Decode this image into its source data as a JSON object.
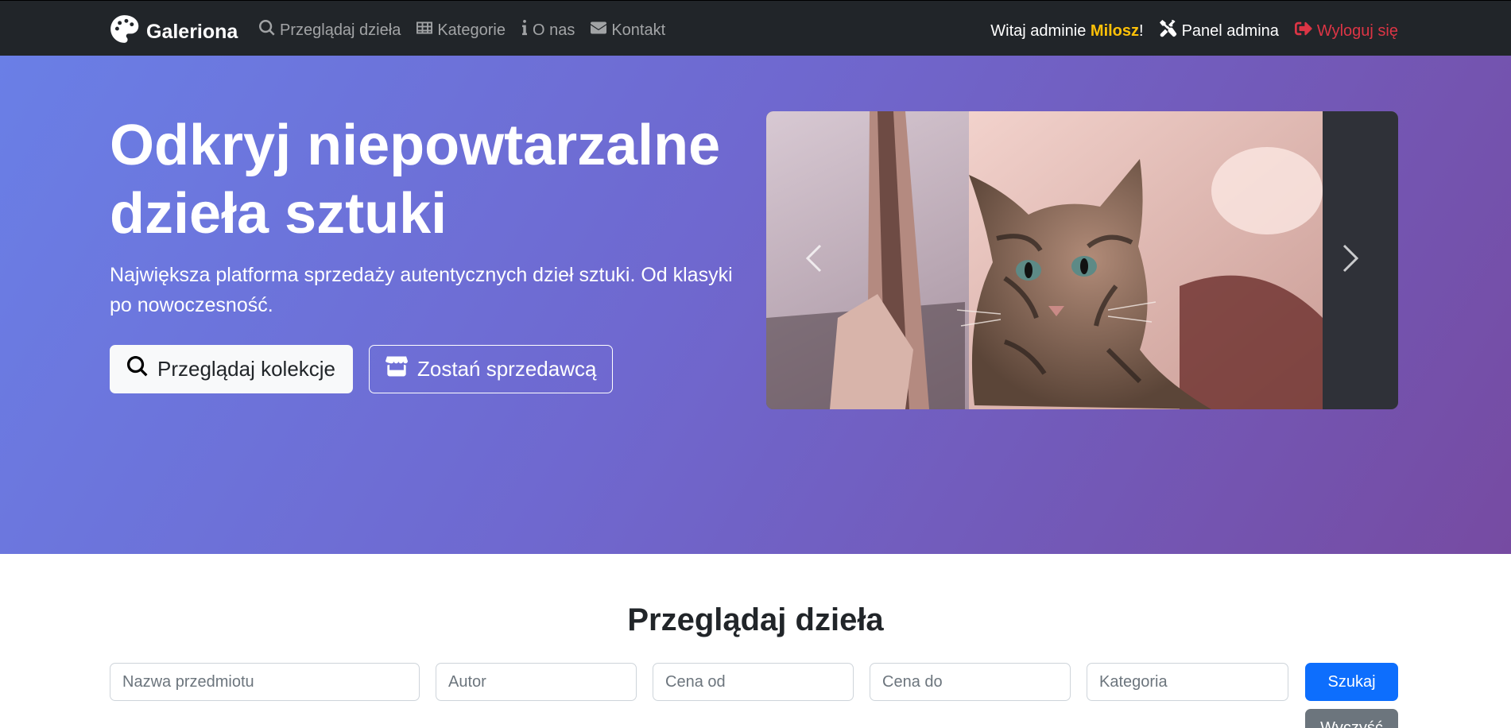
{
  "navbar": {
    "brand": "Galeriona",
    "links": [
      {
        "label": "Przeglądaj dzieła",
        "icon": "search-icon"
      },
      {
        "label": "Kategorie",
        "icon": "table-icon"
      },
      {
        "label": "O nas",
        "icon": "info-icon"
      },
      {
        "label": "Kontakt",
        "icon": "envelope-icon"
      }
    ],
    "greeting_prefix": "Witaj adminie ",
    "username": "Milosz",
    "greeting_suffix": "!",
    "admin_panel": "Panel admina",
    "logout": "Wyloguj się"
  },
  "hero": {
    "title": "Odkryj niepowtarzalne dzieła sztuki",
    "subtitle": "Największa platforma sprzedaży autentycznych dzieł sztuki. Od klasyki po nowoczesność.",
    "browse_button": "Przeglądaj kolekcje",
    "seller_button": "Zostań sprzedawcą"
  },
  "browse": {
    "title": "Przeglądaj dzieła",
    "placeholders": {
      "name": "Nazwa przedmiotu",
      "author": "Autor",
      "price_from": "Cena od",
      "price_to": "Cena do",
      "category": "Kategoria"
    },
    "search_button": "Szukaj",
    "clear_button": "Wyczyść"
  },
  "colors": {
    "navbar_bg": "#212529",
    "accent_user": "#ffc107",
    "logout": "#dc3545",
    "primary": "#0d6efd",
    "secondary": "#6c757d",
    "hero_gradient_start": "#667eea",
    "hero_gradient_end": "#764ba2"
  }
}
